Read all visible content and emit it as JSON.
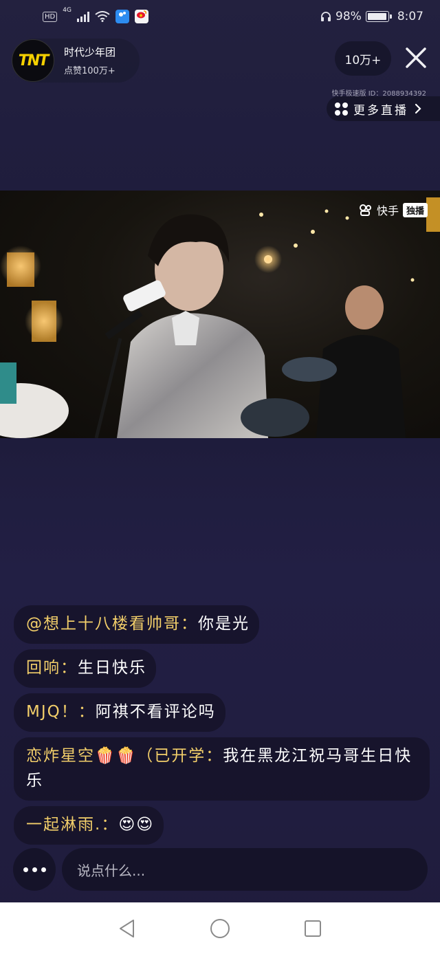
{
  "status_bar": {
    "network": "4G",
    "hd": "HD",
    "battery": "98%",
    "battery_level": 0.98,
    "time": "8:07"
  },
  "host": {
    "logo_text": "TNT",
    "name": "时代少年团",
    "likes": "点赞100万+"
  },
  "viewers": "10万+",
  "stream_id": "快手极速版 ID：2088934392",
  "more_live": "更多直播",
  "video": {
    "watermark_brand": "快手",
    "watermark_tag": "独播"
  },
  "comments": [
    {
      "user": "@想上十八楼看帅哥",
      "separator": "：",
      "text": "你是光"
    },
    {
      "user": "回响",
      "separator": "：",
      "text": "生日快乐"
    },
    {
      "user": "MJQ！",
      "separator": "：",
      "text": "阿祺不看评论吗"
    },
    {
      "user": "恋炸星空🍿🍿（已开学",
      "separator": "：",
      "text": "我在黑龙江祝马哥生日快乐"
    },
    {
      "user": "一起淋雨.",
      "separator": "：",
      "text": "😍😍"
    }
  ],
  "input": {
    "placeholder": "说点什么..."
  },
  "icons": {
    "close": "close-icon",
    "more_live": "grid-icon",
    "chevron": "chevron-right-icon",
    "more": "more-dots-icon",
    "back": "back-triangle-icon",
    "home": "home-circle-icon",
    "recents": "recents-square-icon"
  },
  "colors": {
    "username": "#f3cf6a",
    "background": "#1f1d3d",
    "nav_bar": "#ffffff"
  }
}
